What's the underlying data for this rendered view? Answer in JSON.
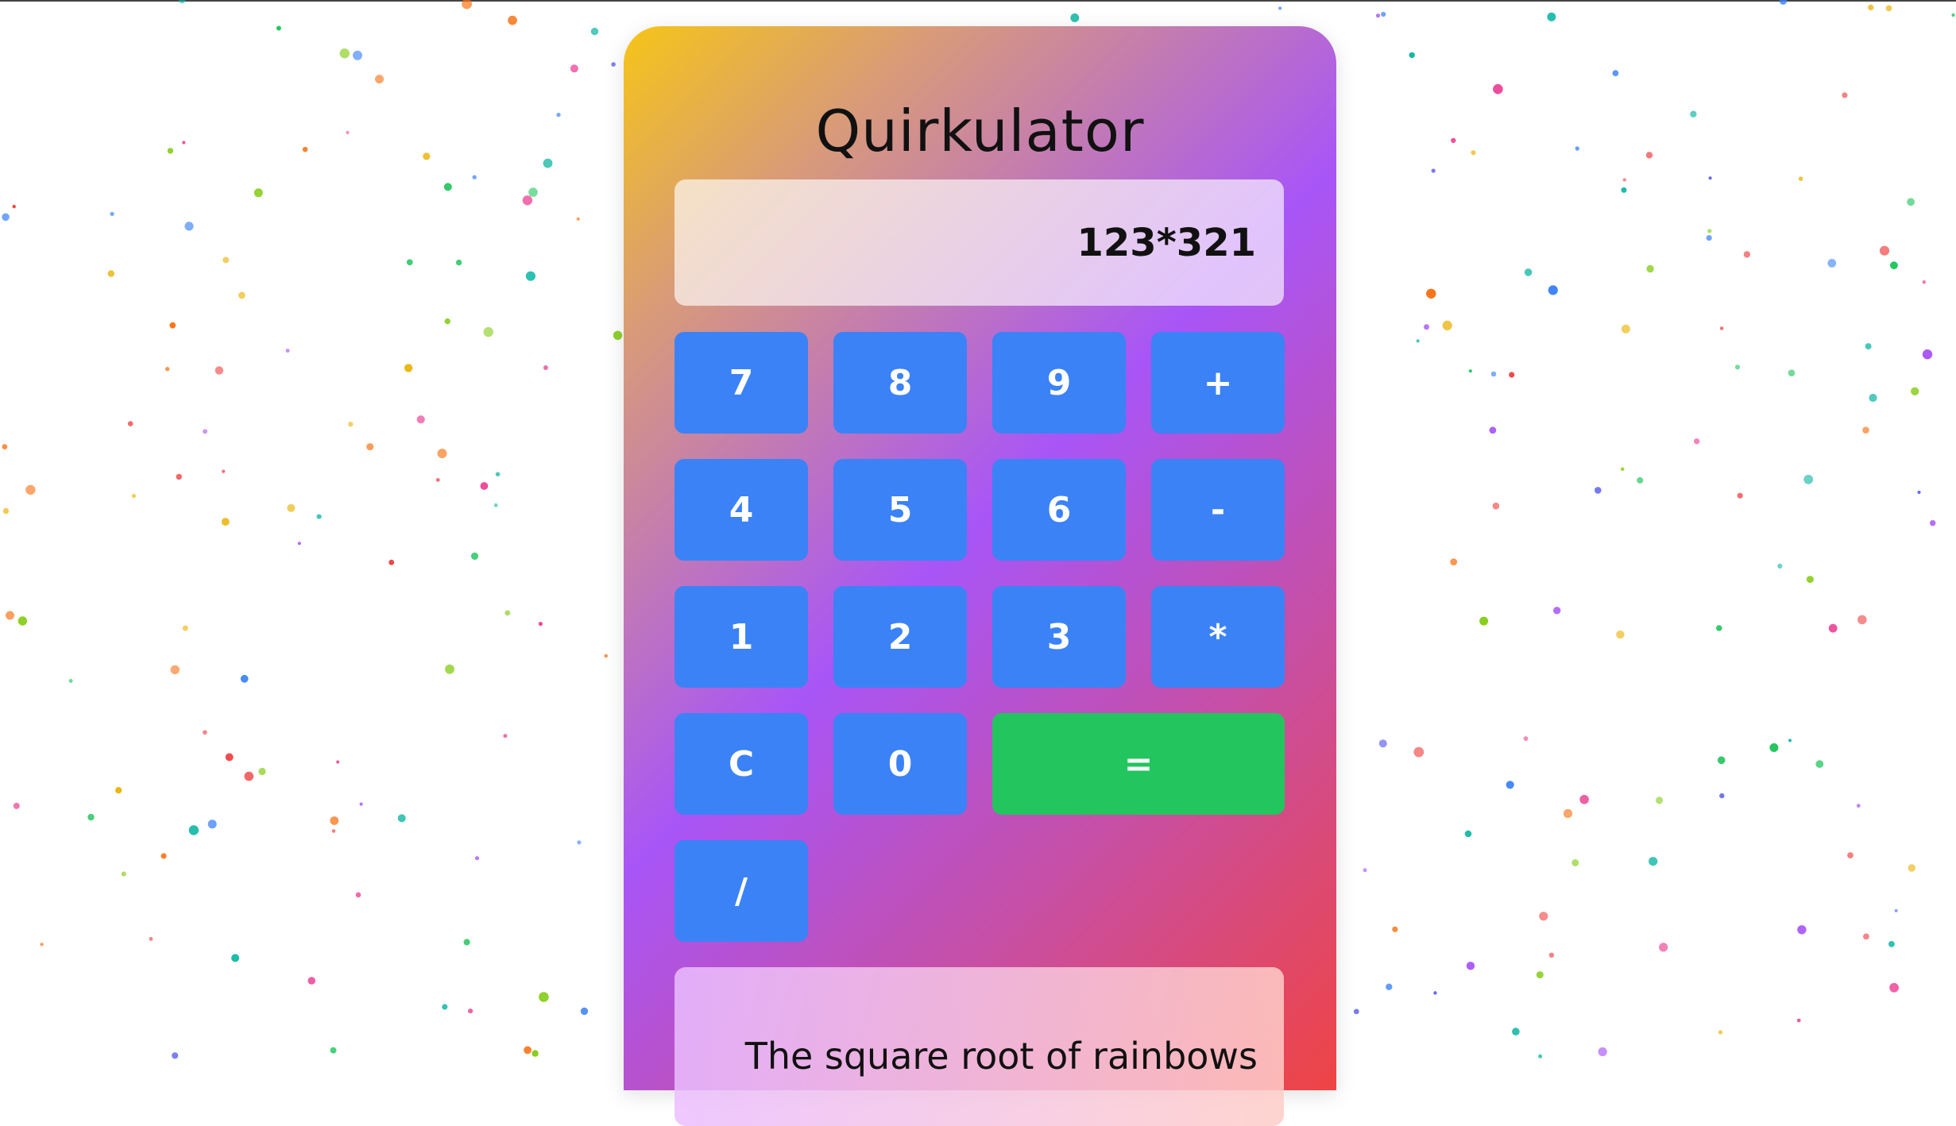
{
  "app": {
    "title": "Quirkulator"
  },
  "display": {
    "expression": "123*321"
  },
  "keypad": {
    "rows": [
      [
        "7",
        "8",
        "9",
        "+"
      ],
      [
        "4",
        "5",
        "6",
        "-"
      ],
      [
        "1",
        "2",
        "3",
        "*"
      ],
      [
        "C",
        "0",
        "="
      ],
      [
        "/"
      ]
    ]
  },
  "message": {
    "text": "The square root of rainbows"
  },
  "colors": {
    "key": "#3b82f6",
    "equals": "#22c55e",
    "gradient_start": "#f5c518",
    "gradient_mid": "#a855f7",
    "gradient_end": "#ef4444"
  }
}
